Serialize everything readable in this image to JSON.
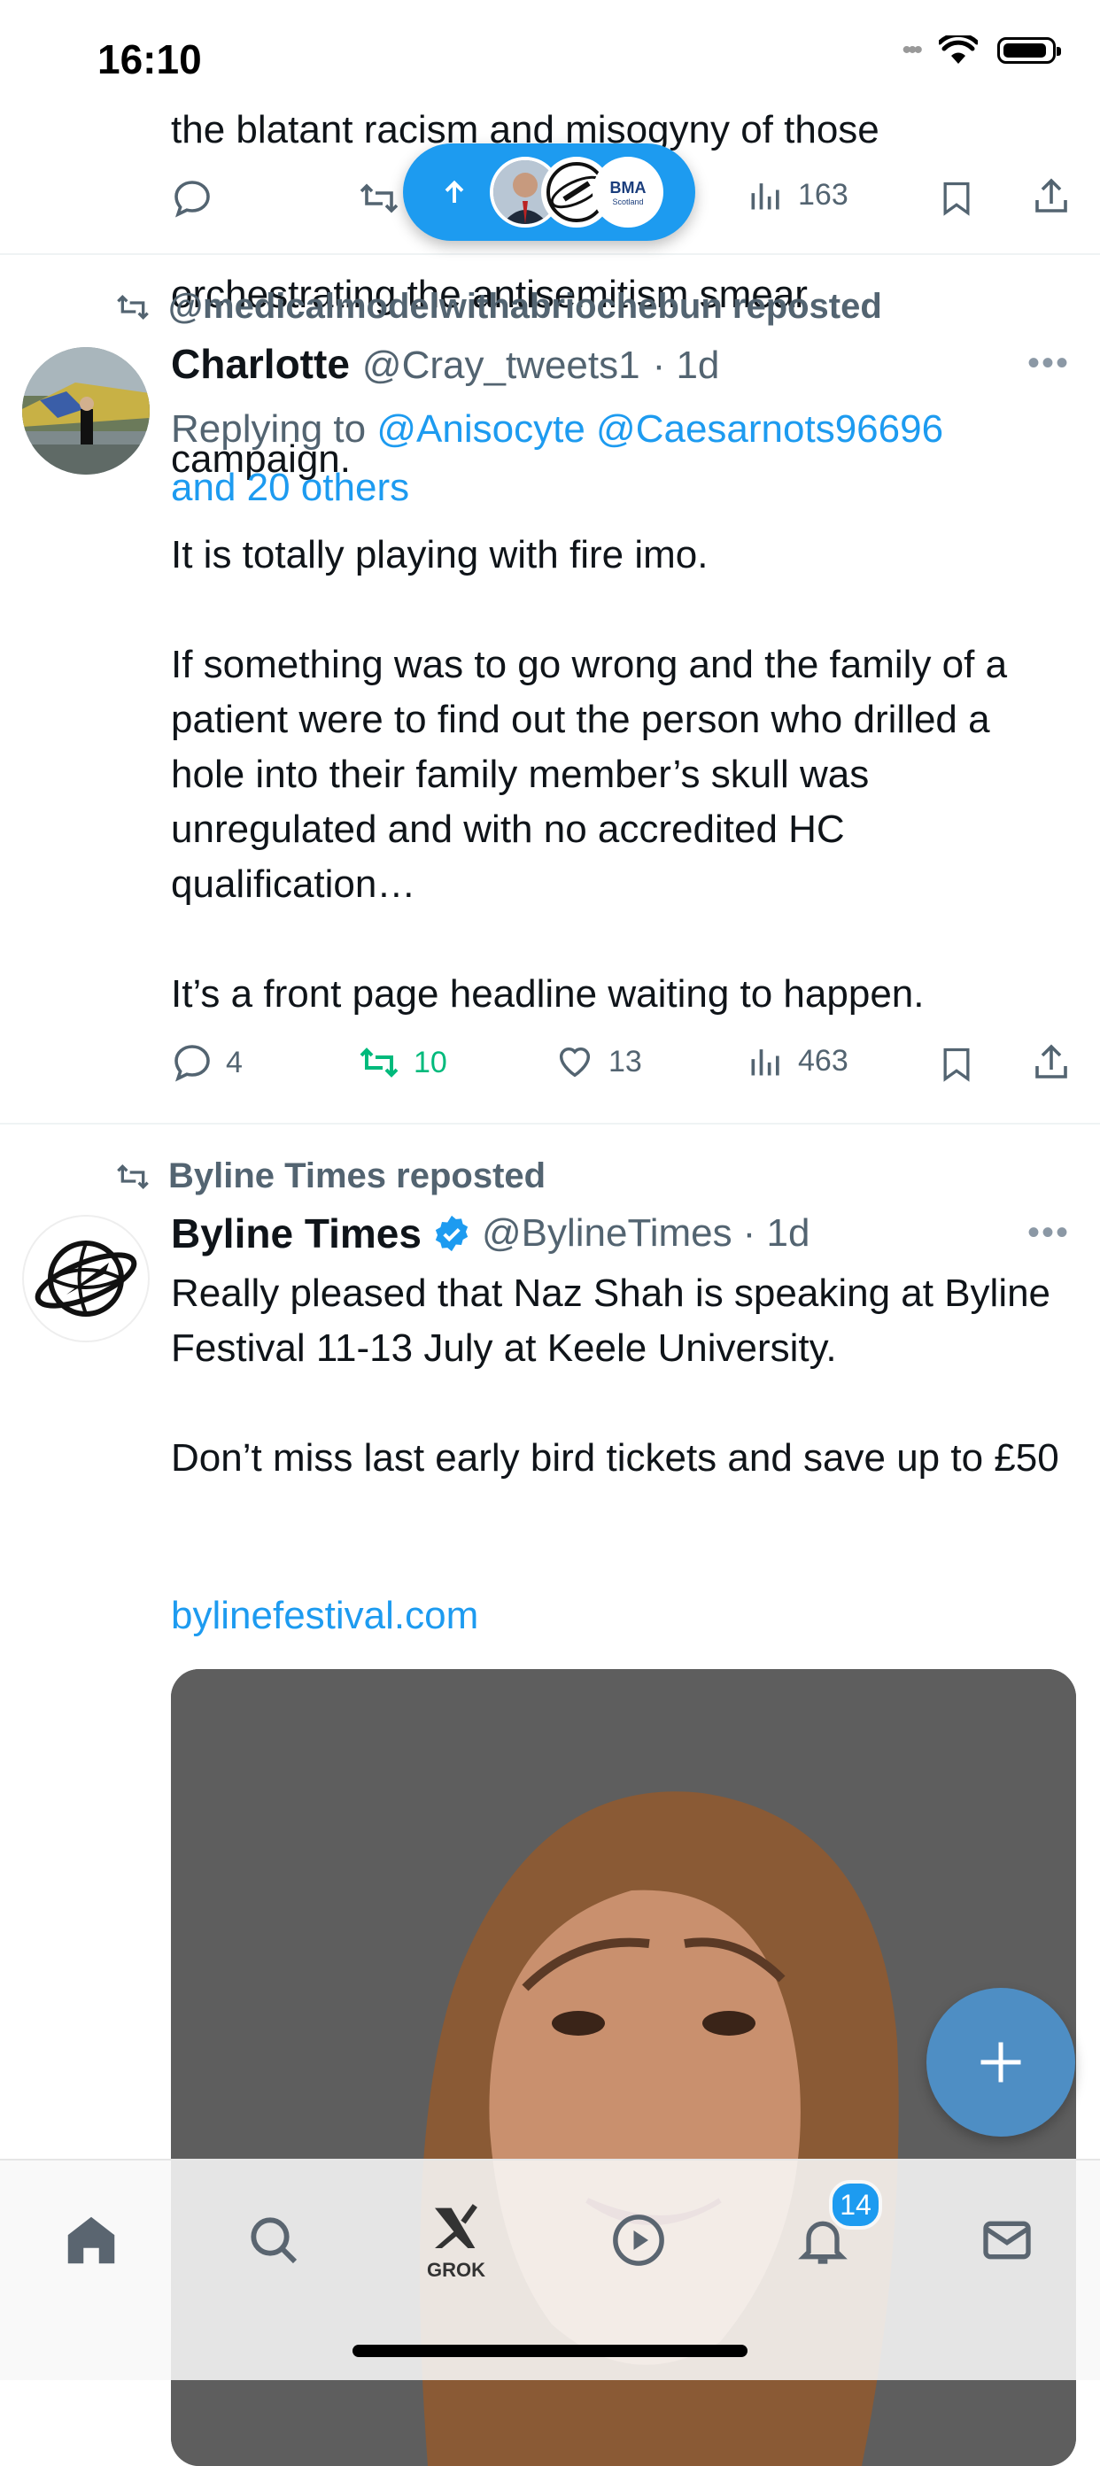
{
  "status_bar": {
    "time": "16:10"
  },
  "prev_tweet": {
    "text_lines": [
      "the blatant racism and misogyny of those",
      "orchestrating the antisemitism smear",
      "campaign."
    ],
    "views": "163"
  },
  "new_posts_pill": {
    "avatar_label": "BMA",
    "avatar_sublabel": "Scotland"
  },
  "tweet1": {
    "repost_by": "@medicalmodelwithabriochebun reposted",
    "name": "Charlotte",
    "handle": "@Cray_tweets1",
    "time": "· 1d",
    "replying_prefix": "Replying to",
    "replying_handles": "@Anisocyte @Caesarnots96696",
    "replying_others": "and 20 others",
    "text": "It is totally playing with fire imo.\n\nIf something was to go wrong and the family of a patient were to find out the person who drilled a hole into their family member’s skull was unregulated and with no accredited HC qualification…\n\nIt’s a front page headline waiting to happen.",
    "replies": "4",
    "reposts": "10",
    "likes": "13",
    "views": "463"
  },
  "tweet2": {
    "repost_by": "Byline Times reposted",
    "name": "Byline Times",
    "handle": "@BylineTimes",
    "time": "· 1d",
    "text": "Really pleased that Naz Shah is speaking at Byline Festival 11-13 July at Keele University.\n\nDon’t miss last early bird tickets and save up to £50",
    "link": "bylinefestival.com"
  },
  "bottom_nav": {
    "grok_label": "GROK",
    "notifications_badge": "14"
  },
  "colors": {
    "accent": "#1d9bf0",
    "repost_green": "#00ba7c",
    "muted": "#536471"
  }
}
